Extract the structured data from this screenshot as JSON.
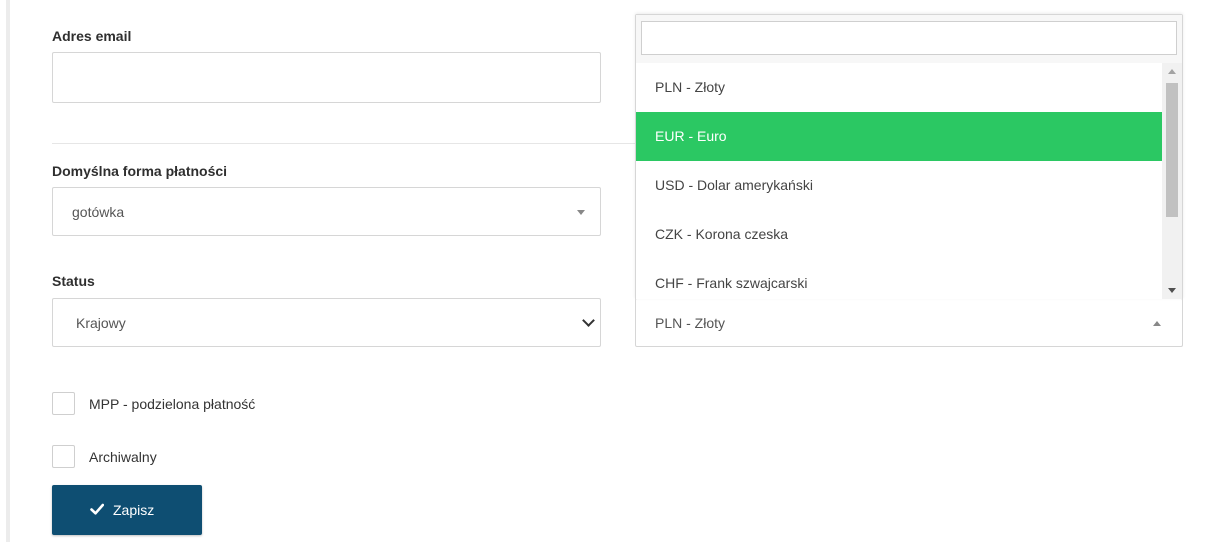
{
  "email": {
    "label": "Adres email",
    "value": ""
  },
  "payment_method": {
    "label": "Domyślna forma płatności",
    "selected": "gotówka"
  },
  "status": {
    "label": "Status",
    "selected": "Krajowy"
  },
  "currency": {
    "selected": "PLN - Złoty",
    "search_value": "",
    "highlighted": "EUR - Euro",
    "options": [
      "PLN - Złoty",
      "EUR - Euro",
      "USD - Dolar amerykański",
      "CZK - Korona czeska",
      "CHF - Frank szwajcarski"
    ]
  },
  "checkboxes": {
    "mpp_label": "MPP - podzielona płatność",
    "mpp_checked": false,
    "archived_label": "Archiwalny",
    "archived_checked": false
  },
  "save_button": {
    "label": "Zapisz",
    "icon": "check-icon",
    "color": "#0e4e72"
  },
  "colors": {
    "highlight": "#2bc863"
  }
}
